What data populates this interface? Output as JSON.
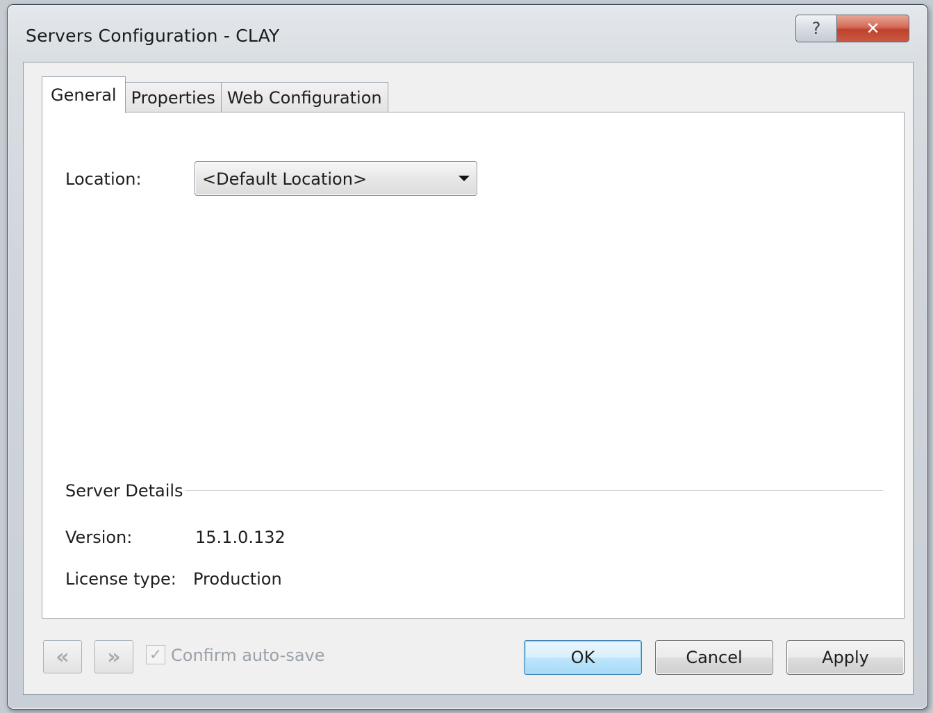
{
  "window": {
    "title": "Servers Configuration - CLAY",
    "help_glyph": "?",
    "close_glyph": "✕"
  },
  "tabs": [
    {
      "label": "General",
      "active": true
    },
    {
      "label": "Properties",
      "active": false
    },
    {
      "label": "Web Configuration",
      "active": false
    }
  ],
  "general": {
    "location_label": "Location:",
    "location_value": "<Default Location>",
    "server_details_title": "Server Details",
    "version_label": "Version:",
    "version_value": "15.1.0.132",
    "license_label": "License type:",
    "license_value": "Production"
  },
  "footer": {
    "prev_glyph": "«",
    "next_glyph": "»",
    "confirm_checked": true,
    "confirm_check_glyph": "✓",
    "confirm_label": "Confirm auto-save",
    "ok_label": "OK",
    "cancel_label": "Cancel",
    "apply_label": "Apply"
  }
}
